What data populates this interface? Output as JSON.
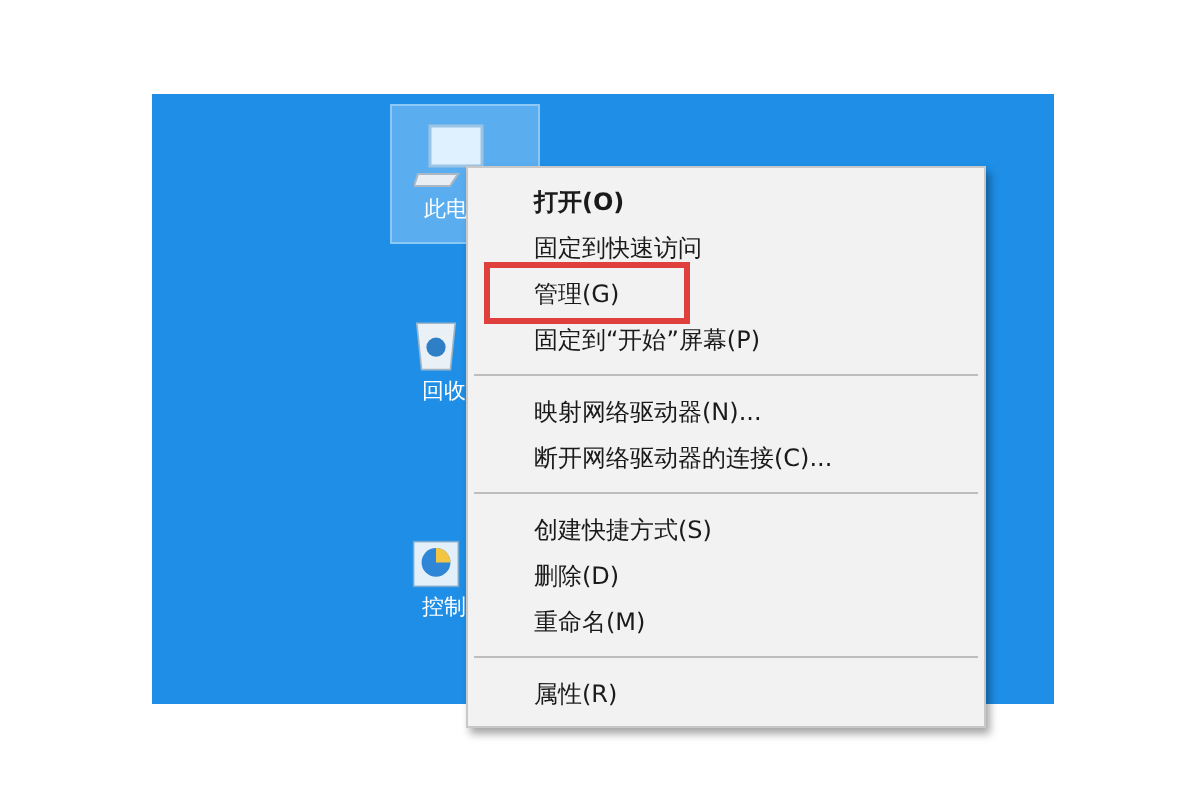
{
  "desktop_icons": [
    {
      "label": "此电",
      "kind": "computer",
      "selected": true
    },
    {
      "label": "回收",
      "kind": "recycle",
      "selected": false
    },
    {
      "label": "控制",
      "kind": "control",
      "selected": false
    }
  ],
  "context_menu": {
    "items": [
      {
        "kind": "item",
        "label": "打开(O)",
        "default": true,
        "highlighted": false
      },
      {
        "kind": "item",
        "label": "固定到快速访问",
        "default": false,
        "highlighted": false
      },
      {
        "kind": "item",
        "label": "管理(G)",
        "default": false,
        "highlighted": true
      },
      {
        "kind": "item",
        "label": "固定到“开始”屏幕(P)",
        "default": false,
        "highlighted": false
      },
      {
        "kind": "separator"
      },
      {
        "kind": "item",
        "label": "映射网络驱动器(N)...",
        "default": false,
        "highlighted": false
      },
      {
        "kind": "item",
        "label": "断开网络驱动器的连接(C)...",
        "default": false,
        "highlighted": false
      },
      {
        "kind": "separator"
      },
      {
        "kind": "item",
        "label": "创建快捷方式(S)",
        "default": false,
        "highlighted": false
      },
      {
        "kind": "item",
        "label": "删除(D)",
        "default": false,
        "highlighted": false
      },
      {
        "kind": "item",
        "label": "重命名(M)",
        "default": false,
        "highlighted": false
      },
      {
        "kind": "separator"
      },
      {
        "kind": "item",
        "label": "属性(R)",
        "default": false,
        "highlighted": false
      }
    ]
  }
}
